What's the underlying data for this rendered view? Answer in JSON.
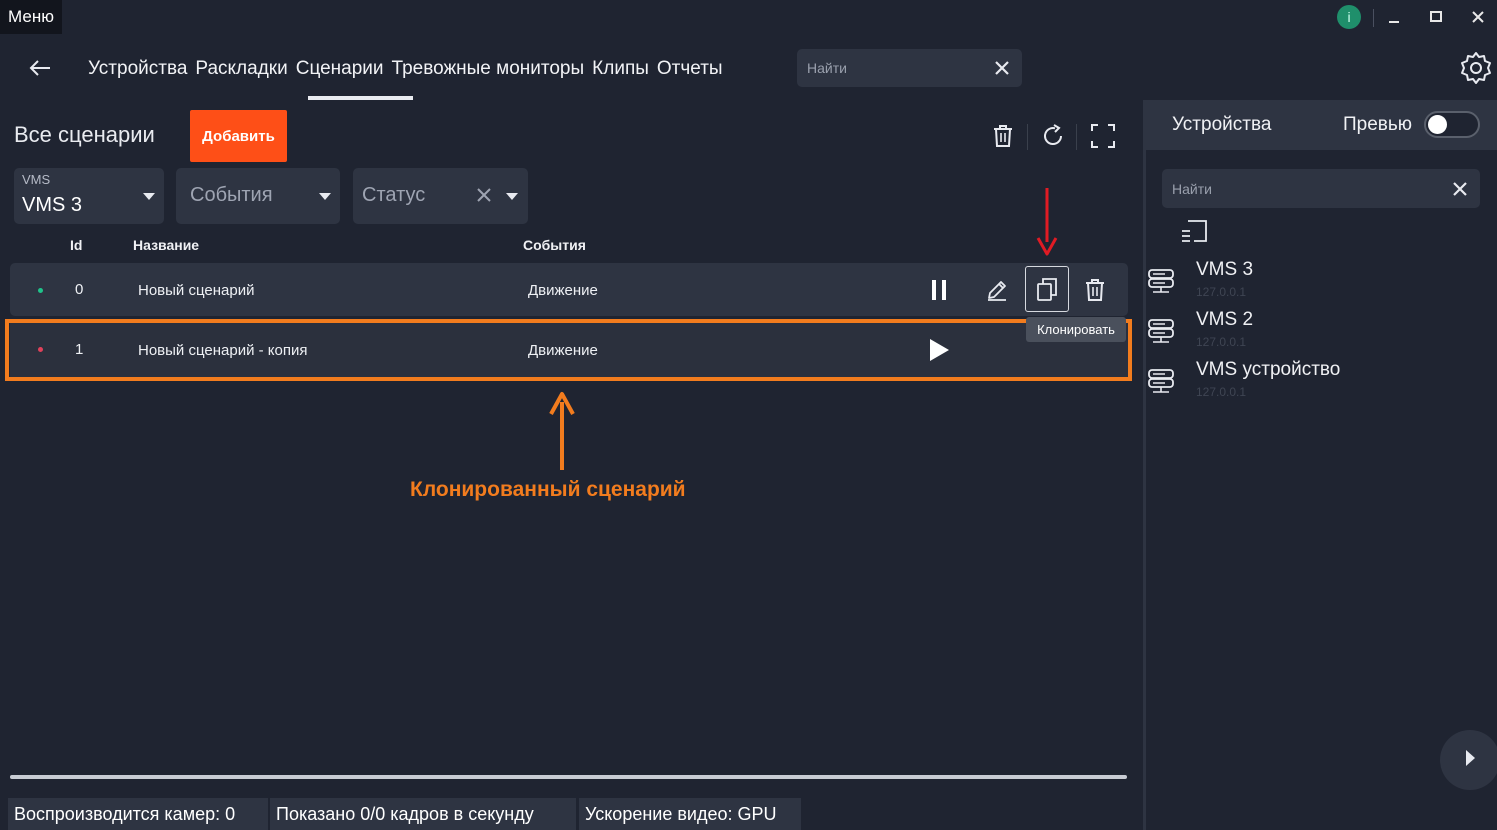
{
  "titlebar": {
    "menu_label": "Меню",
    "info_icon": "info-icon",
    "info_glyph": "i"
  },
  "nav": {
    "tabs": [
      {
        "label": "Устройства"
      },
      {
        "label": "Раскладки"
      },
      {
        "label": "Сценарии",
        "active": true
      },
      {
        "label": "Тревожные мониторы"
      },
      {
        "label": "Клипы"
      },
      {
        "label": "Отчеты"
      }
    ],
    "search_placeholder": "Найти"
  },
  "main": {
    "title": "Все сценарии",
    "add_label": "Добавить",
    "filters": {
      "vms_small": "VMS",
      "vms_value": "VMS 3",
      "events_placeholder": "События",
      "status_placeholder": "Статус"
    },
    "table": {
      "headers": {
        "id": "Id",
        "name": "Название",
        "events": "События"
      },
      "rows": [
        {
          "id": "0",
          "name": "Новый сценарий",
          "events": "Движение",
          "status_color": "#1fc38a"
        },
        {
          "id": "1",
          "name": "Новый сценарий - копия",
          "events": "Движение",
          "status_color": "#e0415a"
        }
      ]
    },
    "tooltip": "Клонировать",
    "annotation": "Клонированный сценарий"
  },
  "statusbar": {
    "cameras": "Воспроизводится камер: 0",
    "fps": "Показано 0/0 кадров в секунду",
    "accel": "Ускорение видео: GPU"
  },
  "side": {
    "title": "Устройства",
    "preview_label": "Превью",
    "preview_on": false,
    "search_placeholder": "Найти",
    "devices": [
      {
        "name": "VMS 3",
        "ip": "127.0.0.1"
      },
      {
        "name": "VMS 2",
        "ip": "127.0.0.1"
      },
      {
        "name": "VMS устройство",
        "ip": "127.0.0.1"
      }
    ]
  },
  "colors": {
    "accent": "#fe4f17",
    "annotation": "#f27c1e",
    "arrow_red": "#e01b24"
  }
}
